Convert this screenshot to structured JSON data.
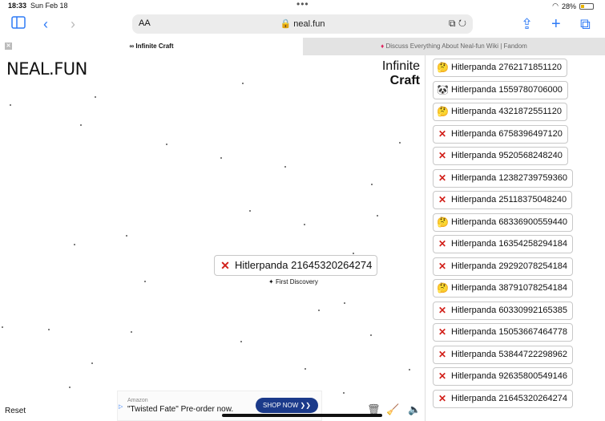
{
  "status": {
    "time": "18:33",
    "date": "Sun Feb 18",
    "battery": "28%"
  },
  "browser": {
    "address": "neal.fun",
    "text_size": "AA",
    "tabs": [
      {
        "label": "∞ Infinite Craft"
      },
      {
        "label": "Discuss Everything About Neal-fun Wiki | Fandom"
      }
    ]
  },
  "page": {
    "logo": "NEAL.FUN",
    "title_line1": "Infinite",
    "title_line2": "Craft",
    "reset": "Reset"
  },
  "canvas_element": {
    "icon": "cross",
    "label": "Hitlerpanda 21645320264274",
    "note": "First Discovery"
  },
  "sidebar_items": [
    {
      "icon": "think",
      "label": "Hitlerpanda 2762171851120"
    },
    {
      "icon": "panda",
      "label": "Hitlerpanda 1559780706000"
    },
    {
      "icon": "think",
      "label": "Hitlerpanda 4321872551120"
    },
    {
      "icon": "cross",
      "label": "Hitlerpanda 6758396497120"
    },
    {
      "icon": "cross",
      "label": "Hitlerpanda 9520568248240"
    },
    {
      "icon": "cross",
      "label": "Hitlerpanda 12382739759360"
    },
    {
      "icon": "cross",
      "label": "Hitlerpanda 25118375048240"
    },
    {
      "icon": "think",
      "label": "Hitlerpanda 68336900559440"
    },
    {
      "icon": "cross",
      "label": "Hitlerpanda 16354258294184"
    },
    {
      "icon": "cross",
      "label": "Hitlerpanda 29292078254184"
    },
    {
      "icon": "think",
      "label": "Hitlerpanda 38791078254184"
    },
    {
      "icon": "cross",
      "label": "Hitlerpanda 60330992165385"
    },
    {
      "icon": "cross",
      "label": "Hitlerpanda 15053667464778"
    },
    {
      "icon": "cross",
      "label": "Hitlerpanda 53844722298962"
    },
    {
      "icon": "cross",
      "label": "Hitlerpanda 92635800549146"
    },
    {
      "icon": "cross",
      "label": "Hitlerpanda 21645320264274"
    }
  ],
  "ad": {
    "brand": "Amazon",
    "text": "\"Twisted Fate\" Pre-order now.",
    "button": "SHOP NOW ❯❯"
  }
}
